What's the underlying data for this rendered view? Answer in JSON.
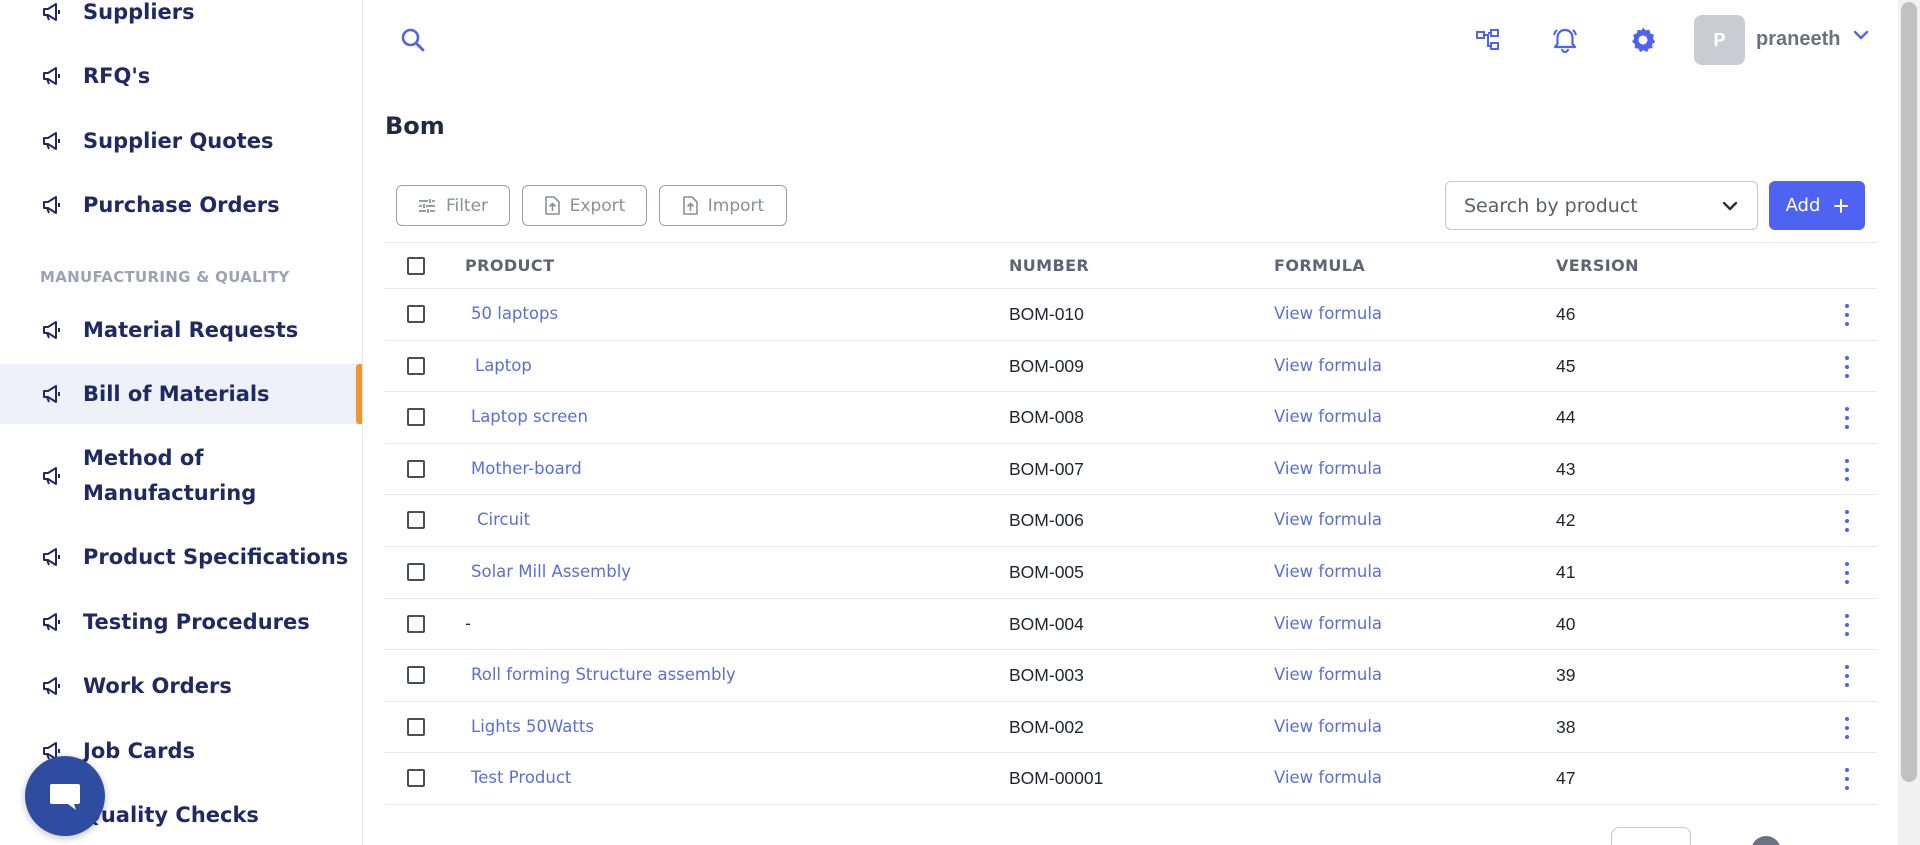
{
  "sidebar": {
    "items_top": [
      {
        "label": "Suppliers"
      },
      {
        "label": "RFQ's"
      },
      {
        "label": "Supplier Quotes"
      },
      {
        "label": "Purchase Orders"
      }
    ],
    "section_label": "MANUFACTURING & QUALITY",
    "items_mfg": [
      {
        "label": "Material Requests"
      },
      {
        "label": "Bill of Materials"
      },
      {
        "label": "Method of Manufacturing"
      },
      {
        "label": "Product Specifications"
      },
      {
        "label": "Testing Procedures"
      },
      {
        "label": "Work Orders"
      },
      {
        "label": "Job Cards"
      },
      {
        "label": "Quality Checks"
      }
    ],
    "active_item": "Bill of Materials"
  },
  "header": {
    "avatar_initial": "P",
    "username": "praneeth"
  },
  "page": {
    "title": "Bom"
  },
  "toolbar": {
    "filter_label": "Filter",
    "export_label": "Export",
    "import_label": "Import",
    "search_placeholder": "Search by product",
    "add_label": "Add"
  },
  "table": {
    "columns": [
      "PRODUCT",
      "NUMBER",
      "FORMULA",
      "VERSION"
    ],
    "rows": [
      {
        "product": "50 laptops",
        "number": "BOM-010",
        "formula": "View formula",
        "version": "46"
      },
      {
        "product": " Laptop",
        "number": "BOM-009",
        "formula": "View formula",
        "version": "45"
      },
      {
        "product": "Laptop screen",
        "number": "BOM-008",
        "formula": "View formula",
        "version": "44"
      },
      {
        "product": "Mother-board",
        "number": "BOM-007",
        "formula": "View formula",
        "version": "43"
      },
      {
        "product": " Circuit",
        "number": "BOM-006",
        "formula": "View formula",
        "version": "42"
      },
      {
        "product": "Solar Mill Assembly",
        "number": "BOM-005",
        "formula": "View formula",
        "version": "41"
      },
      {
        "product": "-",
        "number": "BOM-004",
        "formula": "View formula",
        "version": "40"
      },
      {
        "product": "Roll forming Structure assembly",
        "number": "BOM-003",
        "formula": "View formula",
        "version": "39"
      },
      {
        "product": "Lights 50Watts",
        "number": "BOM-002",
        "formula": "View formula",
        "version": "38"
      },
      {
        "product": "Test Product",
        "number": "BOM-00001",
        "formula": "View formula",
        "version": "47"
      }
    ]
  },
  "colors": {
    "accent": "#4f63f2",
    "link": "#5a6fd6",
    "nav_text": "#1f2a63",
    "active_marker": "#f0962e",
    "chat_bubble": "#2f4da0"
  }
}
